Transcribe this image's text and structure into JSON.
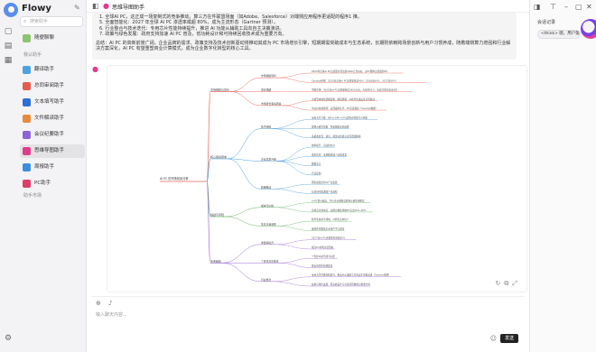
{
  "app": {
    "name": "Flowy",
    "search_placeholder": "搜索助手"
  },
  "sidebar": {
    "user_item": "随便聊聊",
    "section_assistants": "我认助手",
    "section_more": "助手市场",
    "assistants": [
      {
        "label": "翻译助手",
        "color": "#4aa3e0"
      },
      {
        "label": "总同审阅助手",
        "color": "#e65b4c"
      },
      {
        "label": "文本填写助手",
        "color": "#2c6fd6"
      },
      {
        "label": "文件解读助手",
        "color": "#e8893c"
      },
      {
        "label": "会议纪要助手",
        "color": "#8d63d9"
      },
      {
        "label": "思维导图助手",
        "color": "#e13c8a"
      },
      {
        "label": "周报助手",
        "color": "#3c8fe0"
      },
      {
        "label": "PC助手",
        "color": "#e23c6b"
      }
    ]
  },
  "main": {
    "title": "思维导图助手",
    "bubble_lines": [
      "1. 全球AI PC，这正成一场复制式的竞争推动，算三方在件联盟场面（如Adobe、Salesforce）对端侧应用程序更适配的程序1 推。",
      "5. 全面智能化：2027 年全球 AI PC 渗透率或超 80%，成为主流形态（Gartner 预测）。",
      "6. 行业整合与技术迭代：专用芯片性能持续提升，推进 AI 功能从辅助工具向自主决策演进。",
      "7. 政策与绿色发展：政府支持加速 AI PC 普及，低功耗设计和可持续回收技术成为重要方向。"
    ],
    "summary": "总结：AI PC 的高新前景广阔，企业品牌的需求、政策支持及技术创新驱动将推动其成为 PC 市场增长引擎，短期期需突破成本与生态系统，长期则依赖跨场景创新与用户习惯养成，随着端侧算力增强和行业解决方案深化，AI PC 有望重塑商业计算模式，成为企业数字化转型的核心工具。",
    "input_placeholder": "输入聊天内容...",
    "send_label": "发送"
  },
  "right_panel": {
    "label": "会话记录",
    "chip": "<think> 嗯，用户需要一..."
  },
  "mindmap": {
    "root": "AI PC 的市场前景分析",
    "branches": [
      {
        "label": "市场规模与增长",
        "color": "#e8655a",
        "children": [
          {
            "label": "市场规模现状",
            "leaves": [
              "2025年全球AI PC出货量有望达到2000万台左右，占PC整体出货量约8%",
              "Canalys预测：2025年全球AI PC渗透率将达40%（2026年60%，2027年80%）"
            ]
          },
          {
            "label": "增长预期",
            "leaves": [
              "中国市场：2025年AI PC出货量将达3900万台，占比约50%，年复合增长率近3倍"
            ]
          },
          {
            "label": "市场增长驱动因素",
            "leaves": [
              "大模型本地化部署需求、换机周期、AI软件生态完善共同驱动",
              "中关村在线测评：头部品牌主导，PC出货量超（Canalys数据）"
            ]
          }
        ]
      },
      {
        "label": "核心驱动因素",
        "color": "#4a9bd6",
        "children": [
          {
            "label": "技术突破",
            "leaves": [
              "专用芯片升级：NPU+GPU+CPU异构计算提升AI性能",
              "端侧大模型部署：隐私数据本地处理",
              "多模态交互：语音、视觉自然语言交互增强体验"
            ]
          },
          {
            "label": "企业需求升级",
            "leaves": [
              "效率提升：自动化办公",
              "成本优化：本地推理减少云端成本",
              "数据安全",
              "行业定制"
            ]
          },
          {
            "label": "政策推动",
            "leaves": [
              "国家政策支持AI产业发展",
              "信创替代推进国产化进程"
            ]
          }
        ]
      },
      {
        "label": "挑战与风险",
        "color": "#6bb36b",
        "children": [
          {
            "label": "成本与价格",
            "leaves": [
              "AI PC售价偏高，中小企业采购意愿受价格影响明显",
              "高端芯片成本高，初期价格较传统PC高出20%–30%"
            ]
          },
          {
            "label": "生态与兼容性",
            "leaves": [
              "软件生态尚不成熟，AI原生应用较少",
              "兼容性问题及企业用户学习成本"
            ]
          }
        ]
      },
      {
        "label": "未来趋势",
        "color": "#9a6cd8",
        "children": [
          {
            "label": "渗透率提升",
            "leaves": [
              "2027年AI PC渗透率有望超80%",
              "成为PC市场主流形态"
            ]
          },
          {
            "label": "个性化与智能化",
            "leaves": [
              "个性化AI助手成为标配",
              "端云协同的智能体验"
            ]
          },
          {
            "label": "行业整合",
            "leaves": [
              "专用芯片性能持续提升，推动AI从辅助工具向自主决策演进（Gartner预测）",
              "政策与绿色发展：低功耗设计与可持续回收成为重要方向"
            ]
          }
        ]
      }
    ]
  }
}
